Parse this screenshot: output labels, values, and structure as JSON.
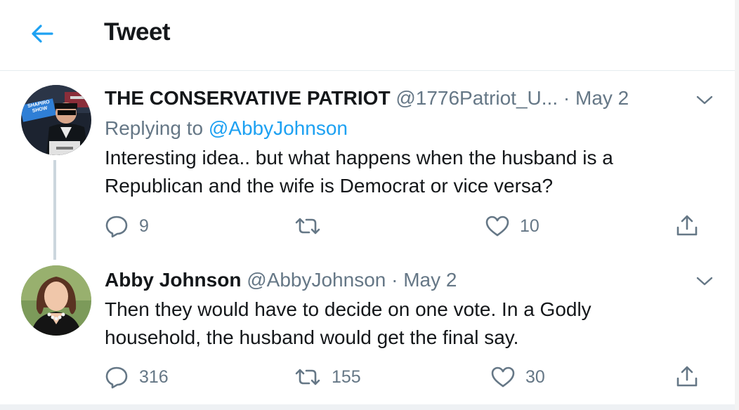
{
  "header": {
    "title": "Tweet"
  },
  "tweets": [
    {
      "name": "THE CONSERVATIVE PATRIOT",
      "handle": "@1776Patriot_U...",
      "separator": "·",
      "date": "May 2",
      "reply_prefix": "Replying to ",
      "reply_to": "@AbbyJohnson",
      "text": "Interesting idea.. but what happens when the husband is a Republican and the wife is Democrat or vice versa?",
      "avatar_badge": "SHAPIRO SHOW",
      "stats": {
        "replies": "9",
        "retweets": "",
        "likes": "10"
      }
    },
    {
      "name": "Abby Johnson",
      "handle": "@AbbyJohnson",
      "separator": "·",
      "date": "May 2",
      "text": "Then they would have to decide on one vote. In a Godly household, the husband would get the final say.",
      "stats": {
        "replies": "316",
        "retweets": "155",
        "likes": "30"
      }
    }
  ],
  "colors": {
    "accent": "#1da1f2",
    "muted": "#657786",
    "text": "#14171a",
    "divider": "#e6ecf0"
  },
  "icons": [
    "back-arrow-icon",
    "chevron-down-icon",
    "reply-icon",
    "retweet-icon",
    "like-icon",
    "share-icon"
  ]
}
